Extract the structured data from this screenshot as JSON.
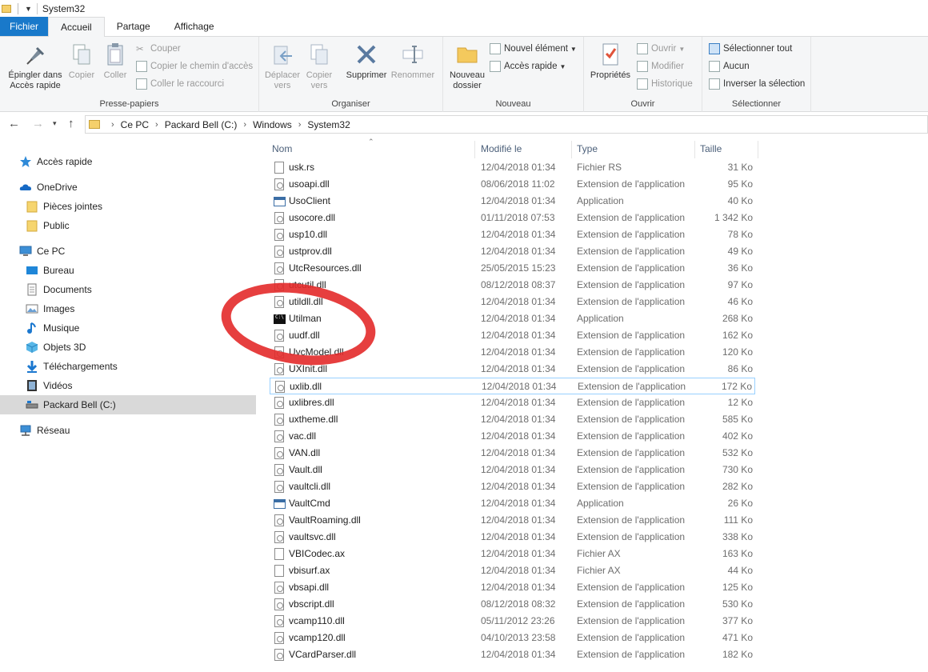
{
  "window": {
    "title": "System32"
  },
  "tabs": [
    {
      "label": "Fichier"
    },
    {
      "label": "Accueil"
    },
    {
      "label": "Partage"
    },
    {
      "label": "Affichage"
    }
  ],
  "ribbon": {
    "clipboard": {
      "pin": "Épingler dans Accès rapide",
      "copy": "Copier",
      "paste": "Coller",
      "cut": "Couper",
      "copy_path": "Copier le chemin d'accès",
      "paste_shortcut": "Coller le raccourci",
      "label": "Presse-papiers"
    },
    "organize": {
      "move": "Déplacer vers",
      "copyto": "Copier vers",
      "delete": "Supprimer",
      "rename": "Renommer",
      "label": "Organiser"
    },
    "new": {
      "new_folder": "Nouveau dossier",
      "new_item": "Nouvel élément",
      "quick_access": "Accès rapide",
      "label": "Nouveau"
    },
    "open": {
      "properties": "Propriétés",
      "open": "Ouvrir",
      "edit": "Modifier",
      "history": "Historique",
      "label": "Ouvrir"
    },
    "select": {
      "select_all": "Sélectionner tout",
      "none": "Aucun",
      "invert": "Inverser la sélection",
      "label": "Sélectionner"
    }
  },
  "address": {
    "crumbs": [
      "Ce PC",
      "Packard Bell (C:)",
      "Windows",
      "System32"
    ]
  },
  "nav": {
    "quick_access": "Accès rapide",
    "onedrive": "OneDrive",
    "attachments": "Pièces jointes",
    "public": "Public",
    "this_pc": "Ce PC",
    "desktop": "Bureau",
    "documents": "Documents",
    "images": "Images",
    "music": "Musique",
    "objects3d": "Objets 3D",
    "downloads": "Téléchargements",
    "videos": "Vidéos",
    "drive": "Packard Bell (C:)",
    "network": "Réseau"
  },
  "columns": {
    "name": "Nom",
    "modified": "Modifié le",
    "type": "Type",
    "size": "Taille"
  },
  "files": [
    {
      "name": "usk.rs",
      "date": "12/04/2018 01:34",
      "type": "Fichier RS",
      "size": "31 Ko",
      "icon": "file-icon"
    },
    {
      "name": "usoapi.dll",
      "date": "08/06/2018 11:02",
      "type": "Extension de l'application",
      "size": "95 Ko",
      "icon": "dll-icon"
    },
    {
      "name": "UsoClient",
      "date": "12/04/2018 01:34",
      "type": "Application",
      "size": "40 Ko",
      "icon": "app-icon"
    },
    {
      "name": "usocore.dll",
      "date": "01/11/2018 07:53",
      "type": "Extension de l'application",
      "size": "1 342 Ko",
      "icon": "dll-icon"
    },
    {
      "name": "usp10.dll",
      "date": "12/04/2018 01:34",
      "type": "Extension de l'application",
      "size": "78 Ko",
      "icon": "dll-icon"
    },
    {
      "name": "ustprov.dll",
      "date": "12/04/2018 01:34",
      "type": "Extension de l'application",
      "size": "49 Ko",
      "icon": "dll-icon"
    },
    {
      "name": "UtcResources.dll",
      "date": "25/05/2015 15:23",
      "type": "Extension de l'application",
      "size": "36 Ko",
      "icon": "dll-icon"
    },
    {
      "name": "utcutil.dll",
      "date": "08/12/2018 08:37",
      "type": "Extension de l'application",
      "size": "97 Ko",
      "icon": "dll-icon"
    },
    {
      "name": "utildll.dll",
      "date": "12/04/2018 01:34",
      "type": "Extension de l'application",
      "size": "46 Ko",
      "icon": "dll-icon"
    },
    {
      "name": "Utilman",
      "date": "12/04/2018 01:34",
      "type": "Application",
      "size": "268 Ko",
      "icon": "cmd-icon"
    },
    {
      "name": "uudf.dll",
      "date": "12/04/2018 01:34",
      "type": "Extension de l'application",
      "size": "162 Ko",
      "icon": "dll-icon"
    },
    {
      "name": "UvcModel.dll",
      "date": "12/04/2018 01:34",
      "type": "Extension de l'application",
      "size": "120 Ko",
      "icon": "dll-icon"
    },
    {
      "name": "UXInit.dll",
      "date": "12/04/2018 01:34",
      "type": "Extension de l'application",
      "size": "86 Ko",
      "icon": "dll-icon"
    },
    {
      "name": "uxlib.dll",
      "date": "12/04/2018 01:34",
      "type": "Extension de l'application",
      "size": "172 Ko",
      "icon": "dll-icon",
      "selected": true
    },
    {
      "name": "uxlibres.dll",
      "date": "12/04/2018 01:34",
      "type": "Extension de l'application",
      "size": "12 Ko",
      "icon": "dll-icon"
    },
    {
      "name": "uxtheme.dll",
      "date": "12/04/2018 01:34",
      "type": "Extension de l'application",
      "size": "585 Ko",
      "icon": "dll-icon"
    },
    {
      "name": "vac.dll",
      "date": "12/04/2018 01:34",
      "type": "Extension de l'application",
      "size": "402 Ko",
      "icon": "dll-icon"
    },
    {
      "name": "VAN.dll",
      "date": "12/04/2018 01:34",
      "type": "Extension de l'application",
      "size": "532 Ko",
      "icon": "dll-icon"
    },
    {
      "name": "Vault.dll",
      "date": "12/04/2018 01:34",
      "type": "Extension de l'application",
      "size": "730 Ko",
      "icon": "dll-icon"
    },
    {
      "name": "vaultcli.dll",
      "date": "12/04/2018 01:34",
      "type": "Extension de l'application",
      "size": "282 Ko",
      "icon": "dll-icon"
    },
    {
      "name": "VaultCmd",
      "date": "12/04/2018 01:34",
      "type": "Application",
      "size": "26 Ko",
      "icon": "app-icon"
    },
    {
      "name": "VaultRoaming.dll",
      "date": "12/04/2018 01:34",
      "type": "Extension de l'application",
      "size": "111 Ko",
      "icon": "dll-icon"
    },
    {
      "name": "vaultsvc.dll",
      "date": "12/04/2018 01:34",
      "type": "Extension de l'application",
      "size": "338 Ko",
      "icon": "dll-icon"
    },
    {
      "name": "VBICodec.ax",
      "date": "12/04/2018 01:34",
      "type": "Fichier AX",
      "size": "163 Ko",
      "icon": "file-icon"
    },
    {
      "name": "vbisurf.ax",
      "date": "12/04/2018 01:34",
      "type": "Fichier AX",
      "size": "44 Ko",
      "icon": "file-icon"
    },
    {
      "name": "vbsapi.dll",
      "date": "12/04/2018 01:34",
      "type": "Extension de l'application",
      "size": "125 Ko",
      "icon": "dll-icon"
    },
    {
      "name": "vbscript.dll",
      "date": "08/12/2018 08:32",
      "type": "Extension de l'application",
      "size": "530 Ko",
      "icon": "dll-icon"
    },
    {
      "name": "vcamp110.dll",
      "date": "05/11/2012 23:26",
      "type": "Extension de l'application",
      "size": "377 Ko",
      "icon": "dll-icon"
    },
    {
      "name": "vcamp120.dll",
      "date": "04/10/2013 23:58",
      "type": "Extension de l'application",
      "size": "471 Ko",
      "icon": "dll-icon"
    },
    {
      "name": "VCardParser.dll",
      "date": "12/04/2018 01:34",
      "type": "Extension de l'application",
      "size": "182 Ko",
      "icon": "dll-icon"
    }
  ]
}
